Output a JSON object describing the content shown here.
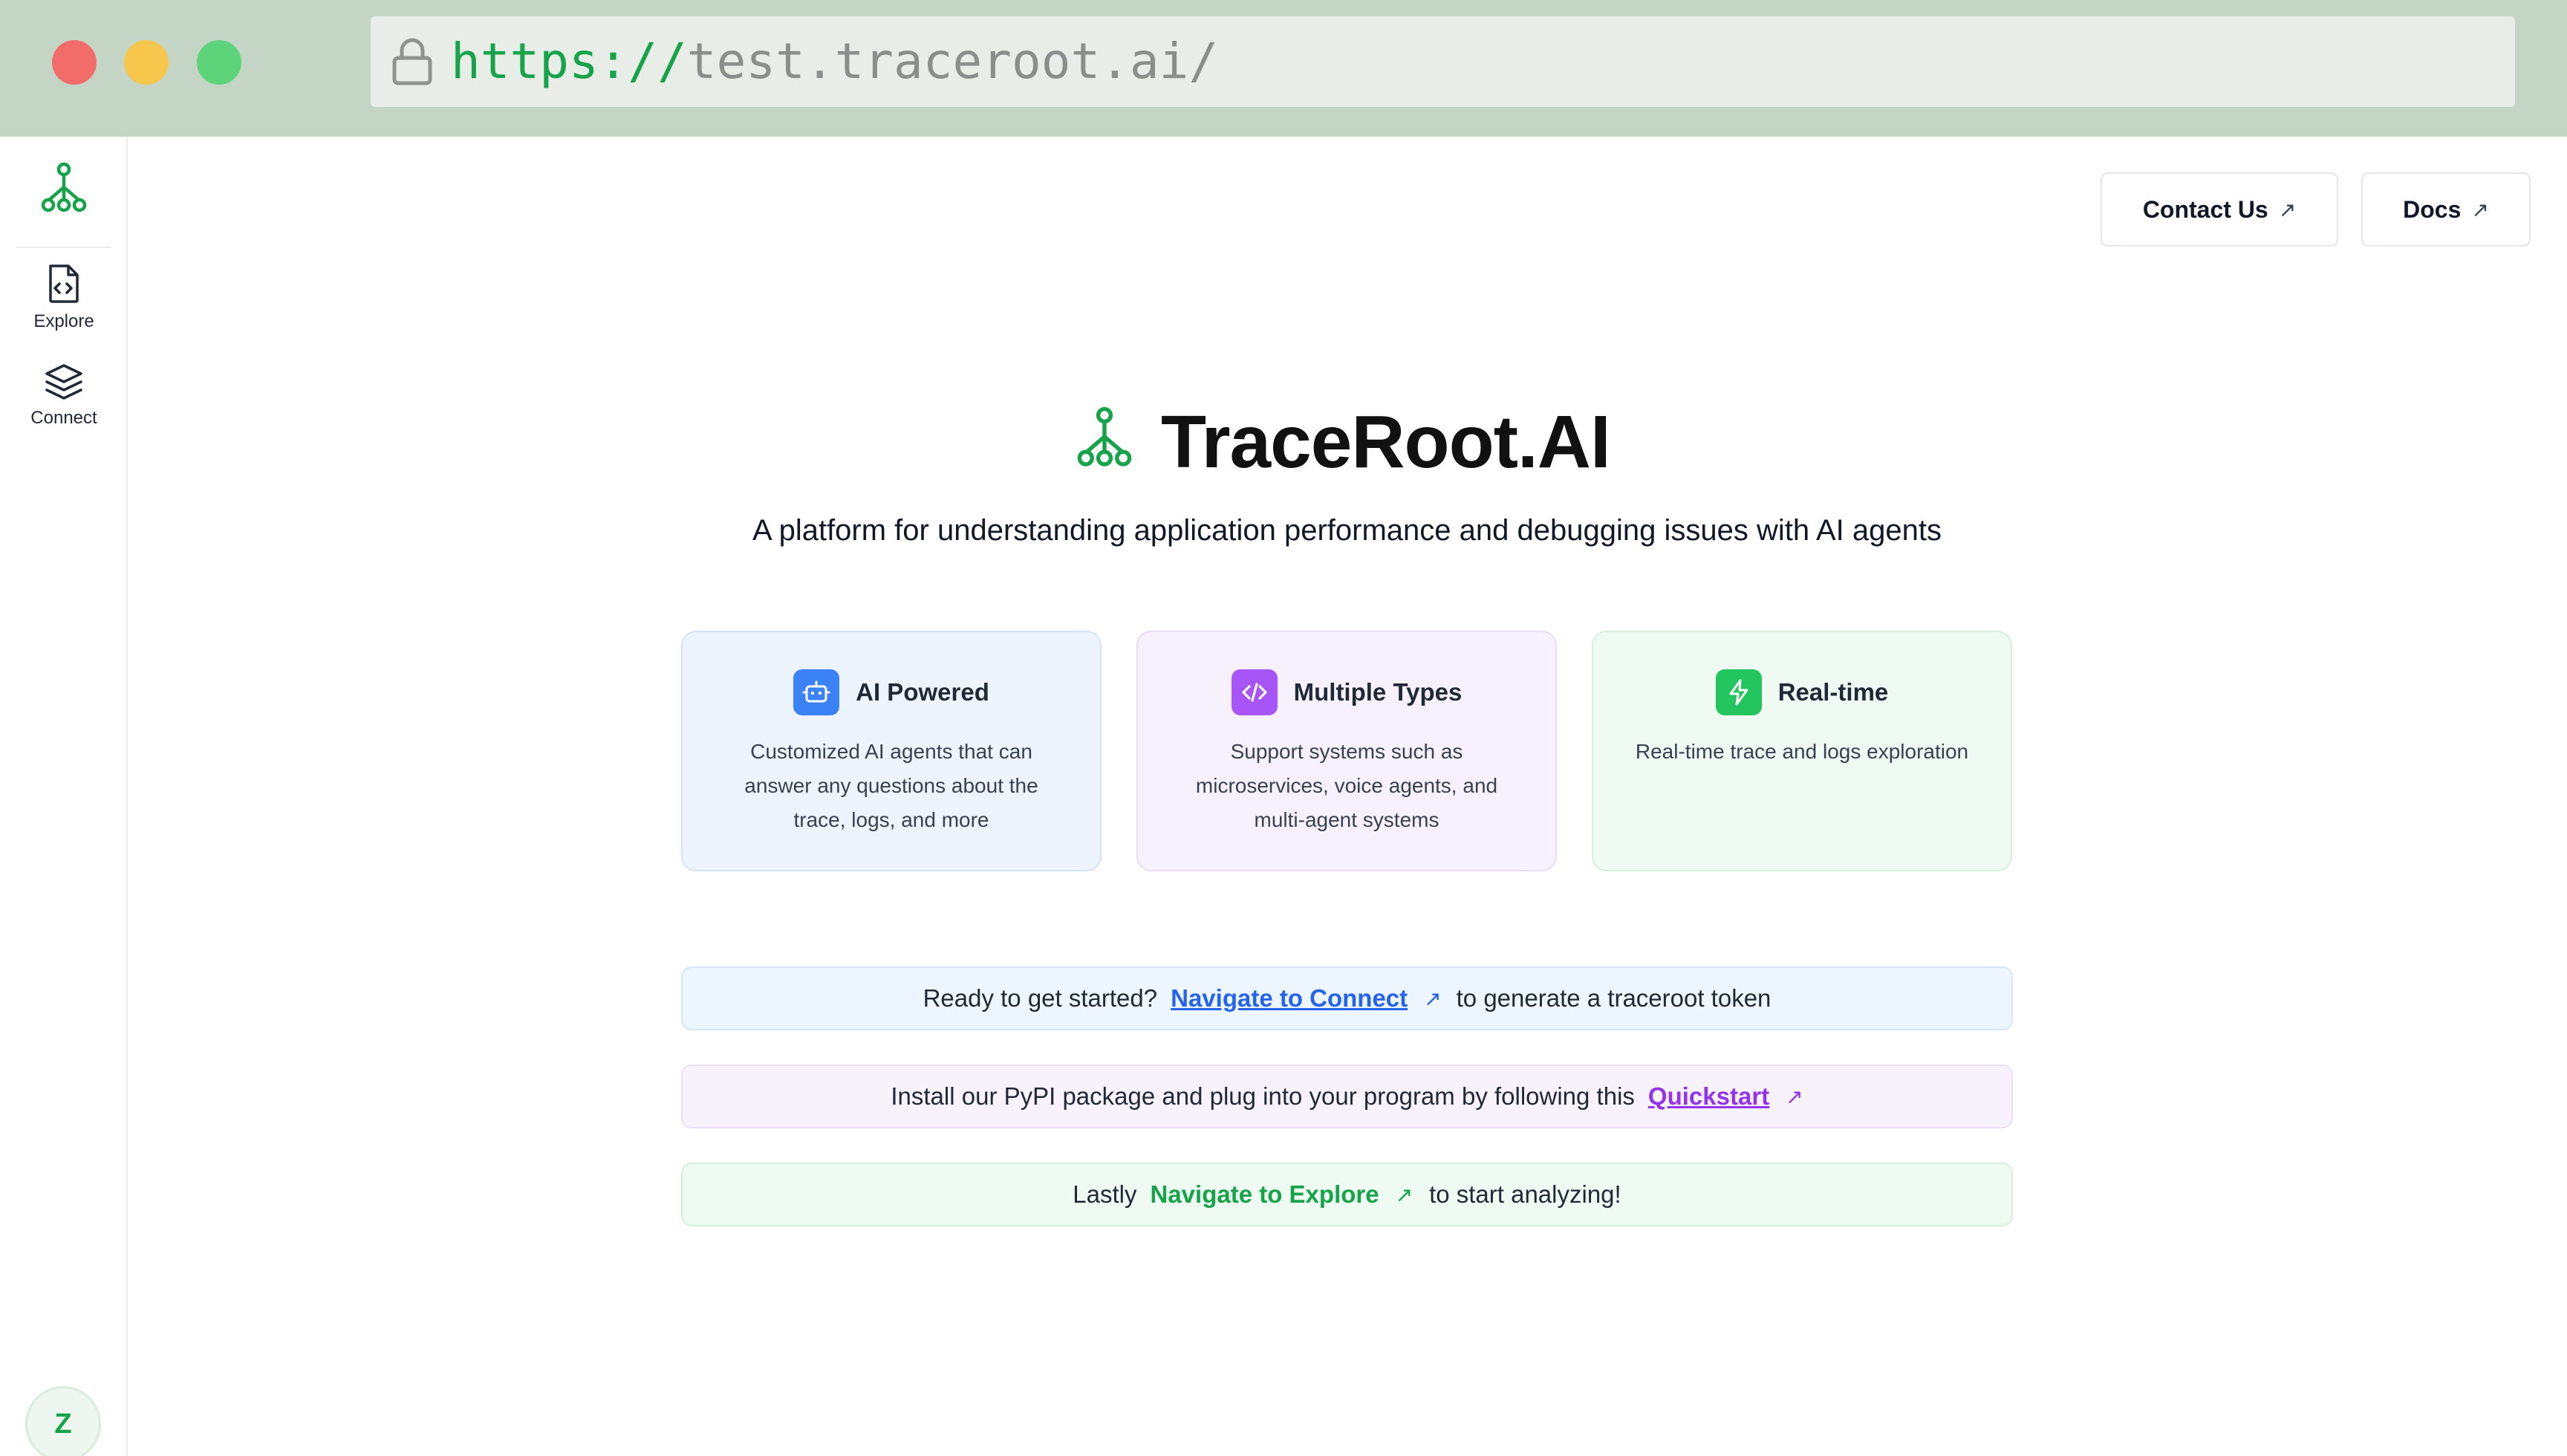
{
  "browser": {
    "url_protocol": "https://",
    "url_host": "test.traceroot.ai/"
  },
  "sidebar": {
    "items": [
      {
        "label": "Explore",
        "icon": "file-code-icon"
      },
      {
        "label": "Connect",
        "icon": "layers-icon"
      }
    ],
    "avatar_initial": "Z"
  },
  "header": {
    "contact_label": "Contact Us",
    "docs_label": "Docs",
    "external_arrow": "↗"
  },
  "hero": {
    "title": "TraceRoot.AI",
    "subtitle": "A platform for understanding application performance and debugging issues with AI agents"
  },
  "features": [
    {
      "title": "AI Powered",
      "description": "Customized AI agents that can answer any questions about the trace, logs, and more",
      "icon": "robot-icon",
      "color": "#3b82f6"
    },
    {
      "title": "Multiple Types",
      "description": "Support systems such as microservices, voice agents, and multi-agent systems",
      "icon": "code-icon",
      "color": "#a855f7"
    },
    {
      "title": "Real-time",
      "description": "Real-time trace and logs exploration",
      "icon": "bolt-icon",
      "color": "#22c55e"
    }
  ],
  "steps": [
    {
      "before": "Ready to get started?",
      "link": "Navigate to Connect",
      "after": "to generate a traceroot token"
    },
    {
      "before": "Install our PyPI package and plug into your program by following this",
      "link": "Quickstart",
      "after": ""
    },
    {
      "before": "Lastly",
      "link": "Navigate to Explore",
      "after": "to start analyzing!"
    }
  ],
  "colors": {
    "brand_green": "#16a34a",
    "blue": "#2563eb",
    "purple": "#9333ea"
  }
}
